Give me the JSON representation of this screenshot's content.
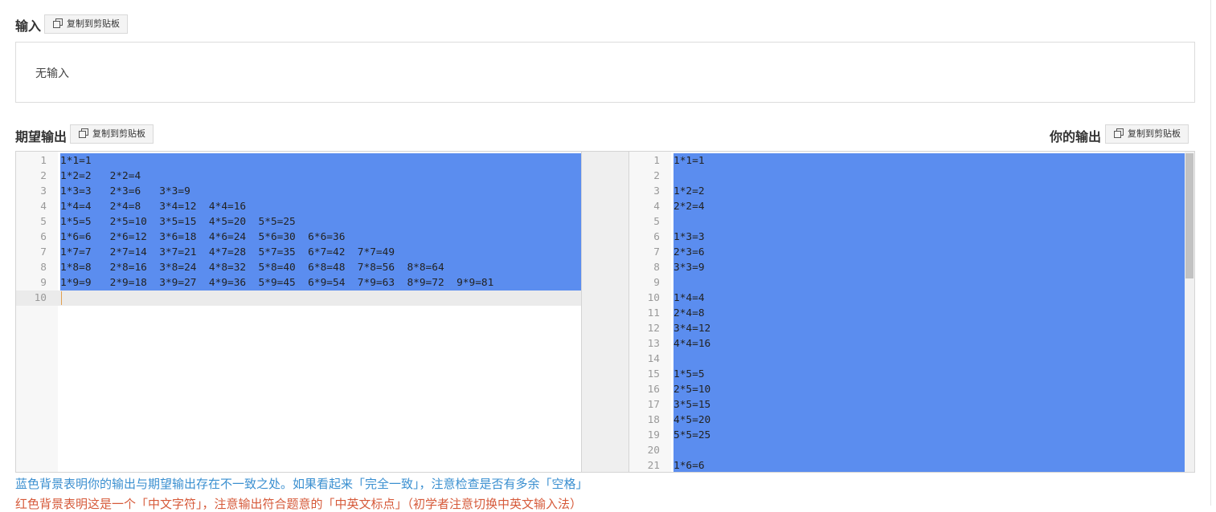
{
  "input": {
    "title": "输入",
    "copy_label": "复制到剪贴板",
    "content": "无输入"
  },
  "expected": {
    "title": "期望输出",
    "copy_label": "复制到剪贴板",
    "lines": [
      "1*1=1",
      "1*2=2   2*2=4",
      "1*3=3   2*3=6   3*3=9",
      "1*4=4   2*4=8   3*4=12  4*4=16",
      "1*5=5   2*5=10  3*5=15  4*5=20  5*5=25",
      "1*6=6   2*6=12  3*6=18  4*6=24  5*6=30  6*6=36",
      "1*7=7   2*7=14  3*7=21  4*7=28  5*7=35  6*7=42  7*7=49",
      "1*8=8   2*8=16  3*8=24  4*8=32  5*8=40  6*8=48  7*8=56  8*8=64",
      "1*9=9   2*9=18  3*9=27  4*9=36  5*9=45  6*9=54  7*9=63  8*9=72  9*9=81",
      ""
    ]
  },
  "actual": {
    "title": "你的输出",
    "copy_label": "复制到剪贴板",
    "lines": [
      "1*1=1",
      "",
      "1*2=2",
      "2*2=4",
      "",
      "1*3=3",
      "2*3=6",
      "3*3=9",
      "",
      "1*4=4",
      "2*4=8",
      "3*4=12",
      "4*4=16",
      "",
      "1*5=5",
      "2*5=10",
      "3*5=15",
      "4*5=20",
      "5*5=25",
      "",
      "1*6=6"
    ]
  },
  "notes": {
    "blue": "蓝色背景表明你的输出与期望输出存在不一致之处。如果看起来「完全一致」，注意检查是否有多余「空格」",
    "red": "红色背景表明这是一个「中文字符」，注意输出符合题意的「中英文标点」（初学者注意切换中英文输入法）"
  },
  "colors": {
    "diff_highlight": "#5b8def",
    "note_blue": "#3a8fd0",
    "note_red": "#d65a3a"
  },
  "icons": {
    "copy": "copy-icon"
  }
}
